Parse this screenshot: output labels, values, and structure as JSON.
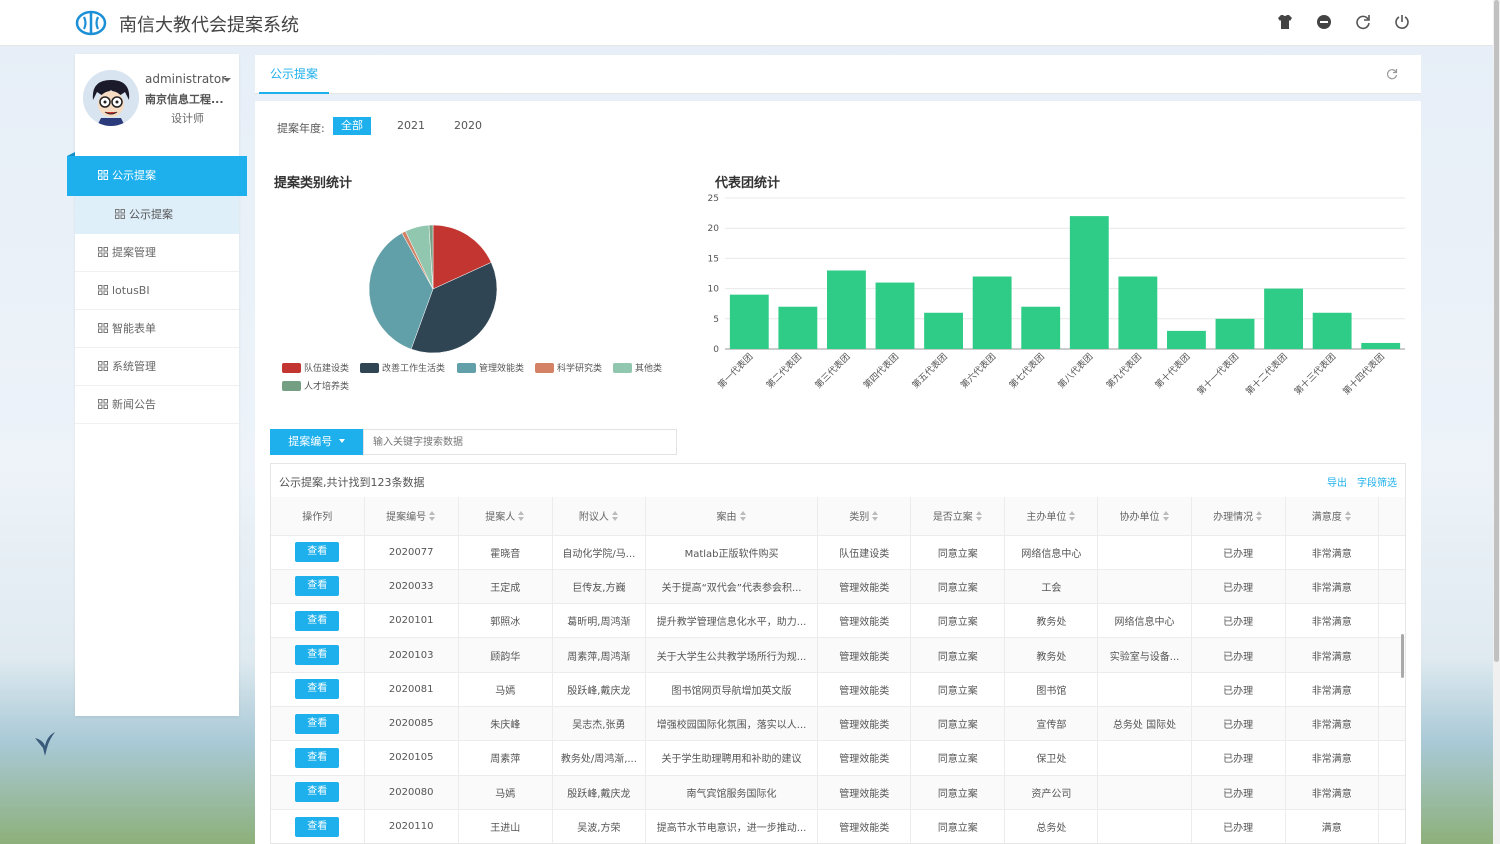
{
  "header": {
    "title": "南信大教代会提案系统",
    "icons": [
      "shirt-icon",
      "minus-circle-icon",
      "refresh-icon",
      "power-icon"
    ]
  },
  "user": {
    "name": "administrator",
    "org": "南京信息工程...",
    "role": "设计师"
  },
  "sidebar": {
    "active": "公示提案",
    "sub": "公示提案",
    "items": [
      "提案管理",
      "lotusBI",
      "智能表单",
      "系统管理",
      "新闻公告"
    ]
  },
  "tab": {
    "label": "公示提案"
  },
  "filter": {
    "label": "提案年度:",
    "years": [
      "全部",
      "2021",
      "2020"
    ],
    "selected": "全部"
  },
  "pie_title": "提案类别统计",
  "bar_title": "代表团统计",
  "chart_data": [
    {
      "type": "pie",
      "title": "提案类别统计",
      "categories": [
        "队伍建设类",
        "改善工作生活类",
        "管理效能类",
        "科学研究类",
        "其他类",
        "人才培养类"
      ],
      "values": [
        18,
        37,
        36,
        1,
        6,
        1
      ],
      "colors": [
        "#c23531",
        "#2f4554",
        "#61a0a8",
        "#d48265",
        "#91c7ae",
        "#749f83"
      ]
    },
    {
      "type": "bar",
      "title": "代表团统计",
      "categories": [
        "第一代表团",
        "第二代表团",
        "第三代表团",
        "第四代表团",
        "第五代表团",
        "第六代表团",
        "第七代表团",
        "第八代表团",
        "第九代表团",
        "第十代表团",
        "第十一代表团",
        "第十二代表团",
        "第十三代表团",
        "第十四代表团"
      ],
      "values": [
        9,
        7,
        13,
        11,
        6,
        12,
        7,
        22,
        12,
        3,
        5,
        10,
        6,
        1
      ],
      "ylim": [
        0,
        25
      ],
      "yticks": [
        0,
        5,
        10,
        15,
        20,
        25
      ],
      "color": "#2ecc87"
    }
  ],
  "search": {
    "button": "提案编号",
    "placeholder": "输入关键字搜索数据"
  },
  "table": {
    "caption": "公示提案,共计找到123条数据",
    "export": "导出",
    "field_filter": "字段筛选",
    "action_label": "查看",
    "columns": [
      "操作列",
      "提案编号",
      "提案人",
      "附议人",
      "案由",
      "类别",
      "是否立案",
      "主办单位",
      "协办单位",
      "办理情况",
      "满意度"
    ],
    "rows": [
      [
        "2020077",
        "霍晓音",
        "自动化学院/马...",
        "Matlab正版软件购买",
        "队伍建设类",
        "同意立案",
        "网络信息中心",
        "",
        "已办理",
        "非常满意"
      ],
      [
        "2020033",
        "王定成",
        "巨传友,方巍",
        "关于提高“双代会”代表参会积...",
        "管理效能类",
        "同意立案",
        "工会",
        "",
        "已办理",
        "非常满意"
      ],
      [
        "2020101",
        "郭照冰",
        "葛昕明,周鸿渐",
        "提升教学管理信息化水平，助力...",
        "管理效能类",
        "同意立案",
        "教务处",
        "网络信息中心",
        "已办理",
        "非常满意"
      ],
      [
        "2020103",
        "顾韵华",
        "周素萍,周鸿渐",
        "关于大学生公共教学场所行为规...",
        "管理效能类",
        "同意立案",
        "教务处",
        "实验室与设备...",
        "已办理",
        "非常满意"
      ],
      [
        "2020081",
        "马嫣",
        "殷跃峰,戴庆龙",
        "图书馆网页导航增加英文版",
        "管理效能类",
        "同意立案",
        "图书馆",
        "",
        "已办理",
        "非常满意"
      ],
      [
        "2020085",
        "朱庆峰",
        "吴志杰,张勇",
        "增强校园国际化氛围，落实以人...",
        "管理效能类",
        "同意立案",
        "宣传部",
        "总务处 国际处",
        "已办理",
        "非常满意"
      ],
      [
        "2020105",
        "周素萍",
        "教务处/周鸿渐,...",
        "关于学生助理聘用和补助的建议",
        "管理效能类",
        "同意立案",
        "保卫处",
        "",
        "已办理",
        "非常满意"
      ],
      [
        "2020080",
        "马嫣",
        "殷跃峰,戴庆龙",
        "南气宾馆服务国际化",
        "管理效能类",
        "同意立案",
        "资产公司",
        "",
        "已办理",
        "非常满意"
      ],
      [
        "2020110",
        "王进山",
        "吴波,方荣",
        "提高节水节电意识，进一步推动...",
        "管理效能类",
        "同意立案",
        "总务处",
        "",
        "已办理",
        "满意"
      ]
    ]
  }
}
